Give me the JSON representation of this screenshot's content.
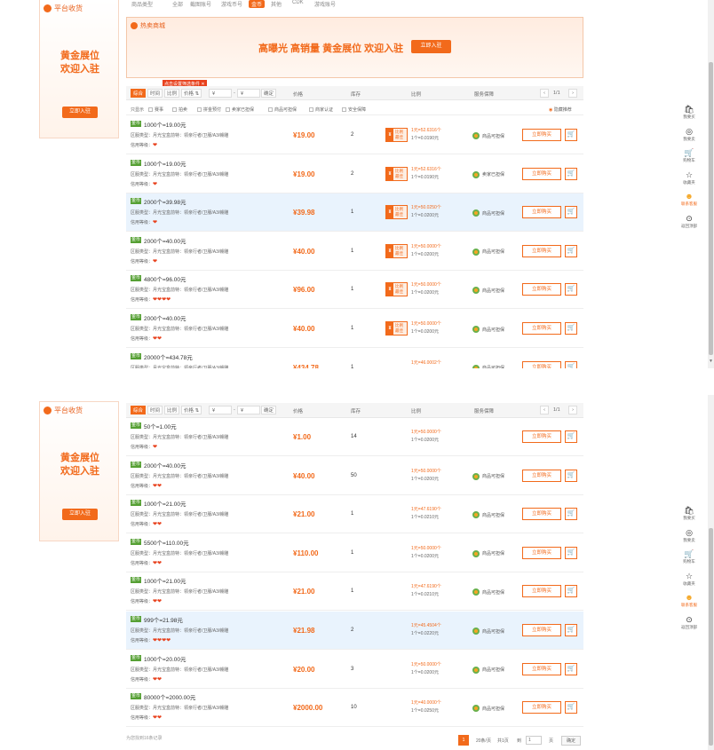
{
  "top_tabs": [
    "商品类型",
    "全部",
    "截图账号",
    "游戏币号",
    "金币",
    "其他",
    "CDK",
    "游戏账号"
  ],
  "promo": {
    "header": "平台收货",
    "line1": "黄金展位",
    "line2": "欢迎入驻",
    "button": "立即入驻"
  },
  "banner": {
    "header": "热卖商城",
    "slogan": "高曝光  高销量  黄金展位  欢迎入驻",
    "button": "立即入驻"
  },
  "sort": {
    "items": [
      "综合",
      "时间",
      "比例",
      "价格"
    ],
    "price_arrow": "⇅",
    "from_placeholder": "¥",
    "to_placeholder": "¥",
    "dash": "-",
    "confirm": "确定",
    "columns": [
      "价格",
      "库存",
      "比例",
      "服务保障"
    ],
    "page": "1/1",
    "prev": "‹",
    "next": "›"
  },
  "tag_tip": "点击设置筛选条件 ✕",
  "filters": [
    "只显示",
    "赛事",
    "拍卖",
    "拼金预付",
    "卖家已担保",
    "商品可担保",
    "商家认证",
    "安全保障"
  ],
  "hide_recommended": "隐藏推荐",
  "row_labels": {
    "tag": "金币",
    "l2_prefix": "区服类型：月光宝盒前特：领亲行者/卫服/A3/赣雕",
    "l3_prefix": "信用等级：",
    "buy": "立即购买",
    "cart": "🛒",
    "badge_left": "¥",
    "badge_right1": "比例",
    "badge_right2": "最佳",
    "svc_default": "商品可担保",
    "svc_seller": "卖家已担保"
  },
  "rows1": [
    {
      "title": "1000个=19.00元",
      "hearts": "❤",
      "price": "¥19.00",
      "stock": "2",
      "badge": true,
      "r1": "1元=52.6316个",
      "r2": "1个=0.0190元",
      "svc": "商品可担保"
    },
    {
      "title": "1000个=19.00元",
      "hearts": "❤",
      "price": "¥19.00",
      "stock": "2",
      "badge": true,
      "r1": "1元=52.6316个",
      "r2": "1个=0.0190元",
      "svc": "卖家已担保"
    },
    {
      "title": "2000个=39.98元",
      "hearts": "❤",
      "price": "¥39.98",
      "stock": "1",
      "badge": true,
      "r1": "1元=50.0250个",
      "r2": "1个=0.0200元",
      "svc": "商品可担保",
      "hl": true
    },
    {
      "title": "2000个=40.00元",
      "hearts": "❤",
      "price": "¥40.00",
      "stock": "1",
      "badge": true,
      "r1": "1元=50.0000个",
      "r2": "1个=0.0200元",
      "svc": "商品可担保"
    },
    {
      "title": "4800个=96.00元",
      "hearts": "❤❤❤❤",
      "price": "¥96.00",
      "stock": "1",
      "badge": true,
      "r1": "1元=50.0000个",
      "r2": "1个=0.0200元",
      "svc": "商品可担保"
    },
    {
      "title": "2000个=40.00元",
      "hearts": "❤❤",
      "price": "¥40.00",
      "stock": "1",
      "badge": true,
      "r1": "1元=50.0000个",
      "r2": "1个=0.0200元",
      "svc": "商品可担保"
    },
    {
      "title": "20000个=434.78元",
      "hearts": "❤",
      "price": "¥434.78",
      "stock": "1",
      "badge": false,
      "r1": "1元=46.0002个",
      "r2": "1个=0.0217元",
      "svc": "商品可担保"
    }
  ],
  "rows2": [
    {
      "title": "50个=1.00元",
      "hearts": "❤",
      "price": "¥1.00",
      "stock": "14",
      "r1": "1元=50.0000个",
      "r2": "1个=0.0200元",
      "svc": ""
    },
    {
      "title": "2000个=40.00元",
      "hearts": "❤❤",
      "price": "¥40.00",
      "stock": "50",
      "r1": "1元=50.0000个",
      "r2": "1个=0.0200元",
      "svc": "商品可担保"
    },
    {
      "title": "1000个=21.00元",
      "hearts": "❤❤",
      "price": "¥21.00",
      "stock": "1",
      "r1": "1元=47.6190个",
      "r2": "1个=0.0210元",
      "svc": "商品可担保"
    },
    {
      "title": "5500个=110.00元",
      "hearts": "❤❤",
      "price": "¥110.00",
      "stock": "1",
      "r1": "1元=50.0000个",
      "r2": "1个=0.0200元",
      "svc": "商品可担保"
    },
    {
      "title": "1000个=21.00元",
      "hearts": "❤❤",
      "price": "¥21.00",
      "stock": "1",
      "r1": "1元=47.6190个",
      "r2": "1个=0.0210元",
      "svc": "商品可担保"
    },
    {
      "title": "999个=21.98元",
      "hearts": "❤❤❤❤",
      "price": "¥21.98",
      "stock": "2",
      "r1": "1元=45.4504个",
      "r2": "1个=0.0220元",
      "svc": "商品可担保",
      "hl": true
    },
    {
      "title": "1000个=20.00元",
      "hearts": "❤❤",
      "price": "¥20.00",
      "stock": "3",
      "r1": "1元=50.0000个",
      "r2": "1个=0.0200元",
      "svc": "商品可担保"
    },
    {
      "title": "80000个=2000.00元",
      "hearts": "❤❤",
      "price": "¥2000.00",
      "stock": "10",
      "r1": "1元=40.0000个",
      "r2": "1个=0.0250元",
      "svc": "商品可担保"
    }
  ],
  "sidebar": [
    {
      "label": "我要买",
      "icon": "basket-icon",
      "glyph": "🛍"
    },
    {
      "label": "我要卖",
      "icon": "sell-icon",
      "glyph": "◎"
    },
    {
      "label": "购物车",
      "icon": "cart-icon",
      "glyph": "🛒"
    },
    {
      "label": "收藏夹",
      "icon": "star-icon",
      "glyph": "☆"
    },
    {
      "label": "联系客服",
      "icon": "service-icon",
      "glyph": "☻",
      "active": true
    },
    {
      "label": "返回顶部",
      "icon": "top-icon",
      "glyph": "⊙"
    }
  ],
  "footer": {
    "summary": "为您找到16条记录",
    "current_page": "1",
    "per_page": "20条/页",
    "total": "共1页",
    "goto": "到",
    "page_value": "1",
    "page_unit": "页",
    "confirm": "确定"
  }
}
